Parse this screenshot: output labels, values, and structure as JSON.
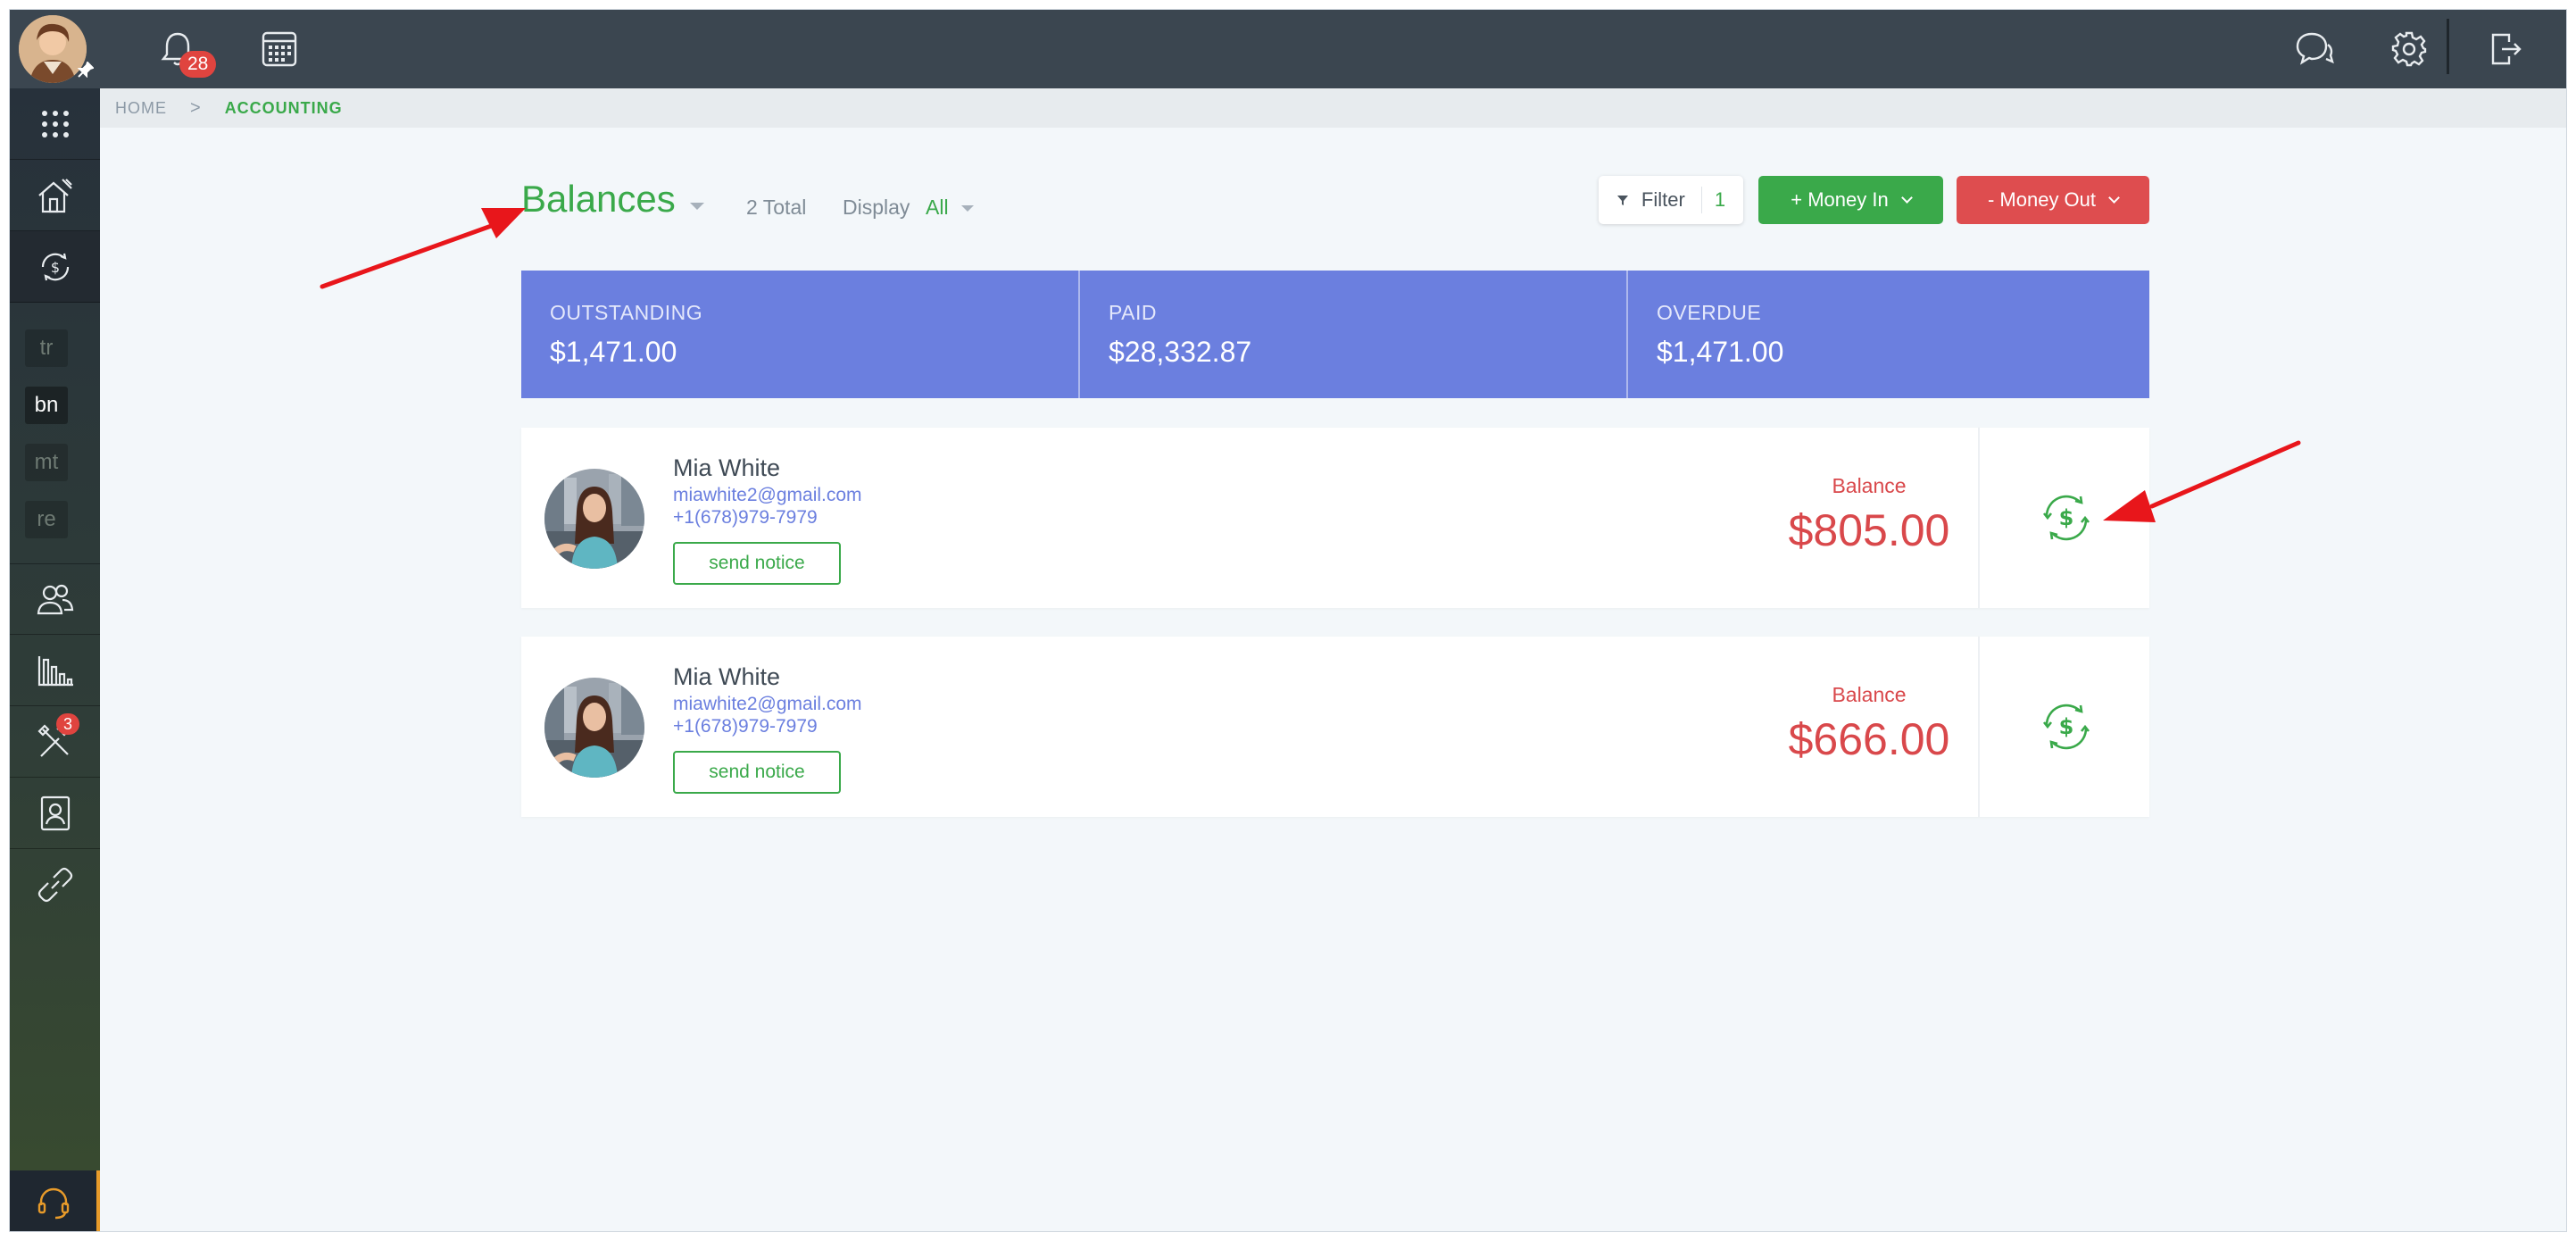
{
  "topbar": {
    "notifications_count": "28",
    "colors": {
      "bar": "#3b4650",
      "badge": "#e0443f"
    }
  },
  "breadcrumb": {
    "home": "HOME",
    "separator": ">",
    "current": "ACCOUNTING"
  },
  "sidebar": {
    "small_items": [
      "tr",
      "bn",
      "mt",
      "re"
    ],
    "tools_badge": "3",
    "icons": [
      "apps-grid-icon",
      "property-icon",
      "accounting-icon",
      "people-icon",
      "reports-icon",
      "tools-icon",
      "contacts-icon",
      "link-icon",
      "support-icon"
    ]
  },
  "main": {
    "title": "Balances",
    "total": "2 Total",
    "display_label": "Display",
    "display_value": "All",
    "filter_label": "Filter",
    "filter_count": "1",
    "money_in_label": "+ Money In",
    "money_out_label": "- Money Out"
  },
  "stats": [
    {
      "label": "OUTSTANDING",
      "value": "$1,471.00"
    },
    {
      "label": "PAID",
      "value": "$28,332.87"
    },
    {
      "label": "OVERDUE",
      "value": "$1,471.00"
    }
  ],
  "balances": [
    {
      "name": "Mia White",
      "email": "miawhite2@gmail.com",
      "phone": "+1(678)979-7979",
      "notice_label": "send notice",
      "balance_label": "Balance",
      "balance": "$805.00"
    },
    {
      "name": "Mia White",
      "email": "miawhite2@gmail.com",
      "phone": "+1(678)979-7979",
      "notice_label": "send notice",
      "balance_label": "Balance",
      "balance": "$666.00"
    }
  ],
  "colors": {
    "accent_green": "#3aa94a",
    "stat_blue": "#6b7fdf",
    "balance_red": "#d9484b",
    "money_out_red": "#de4d4f",
    "annotation_red": "#e8161b"
  }
}
